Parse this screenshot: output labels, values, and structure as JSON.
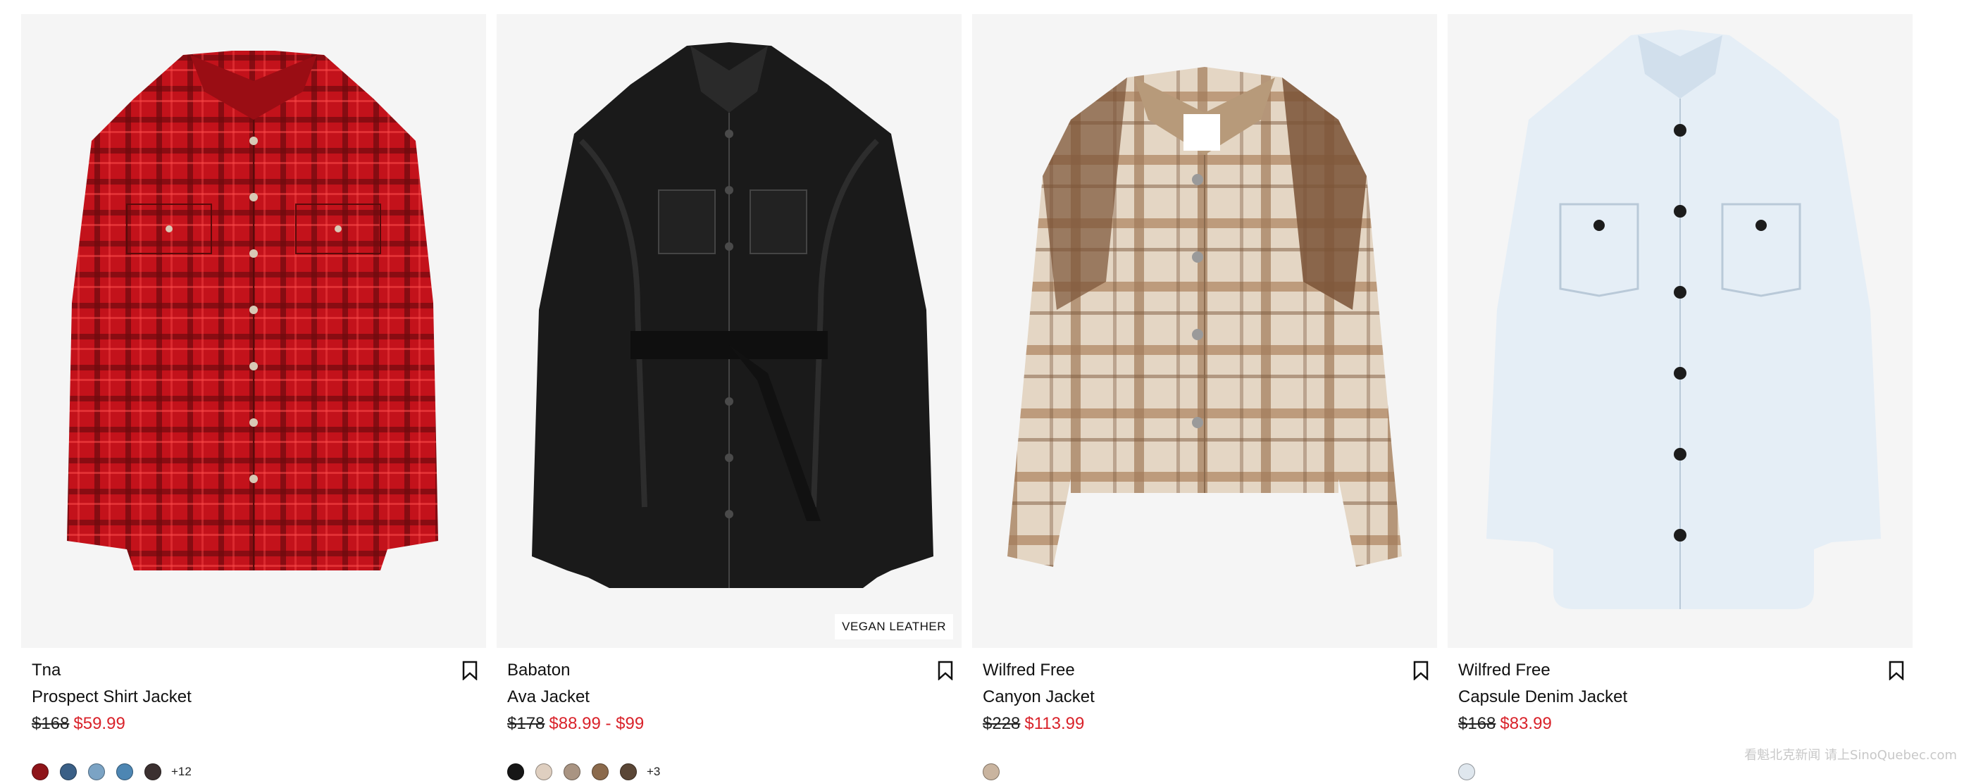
{
  "products": [
    {
      "brand": "Tna",
      "name": "Prospect Shirt Jacket",
      "old_price": "$168",
      "sale_price": "$59.99",
      "badge": "",
      "swatches": [
        "#8e1419",
        "#3a5f86",
        "#7ba3c4",
        "#4d86b3",
        "#3b3030"
      ],
      "more": "+12"
    },
    {
      "brand": "Babaton",
      "name": "Ava Jacket",
      "old_price": "$178",
      "sale_price": "$88.99 - $99",
      "badge": "VEGAN LEATHER",
      "swatches": [
        "#161616",
        "#dfcfc0",
        "#a99482",
        "#8b6a4c",
        "#5a4636"
      ],
      "more": "+3"
    },
    {
      "brand": "Wilfred Free",
      "name": "Canyon Jacket",
      "old_price": "$228",
      "sale_price": "$113.99",
      "badge": "",
      "swatches": [
        "#c9b49f"
      ],
      "more": ""
    },
    {
      "brand": "Wilfred Free",
      "name": "Capsule Denim Jacket",
      "old_price": "$168",
      "sale_price": "$83.99",
      "badge": "",
      "swatches": [
        "#dfe7ee"
      ],
      "more": ""
    }
  ],
  "watermark": "看魁北克新闻 请上SinoQuebec.com",
  "colors": {
    "sale": "#d9222a",
    "image_bg": "#f5f5f5"
  }
}
